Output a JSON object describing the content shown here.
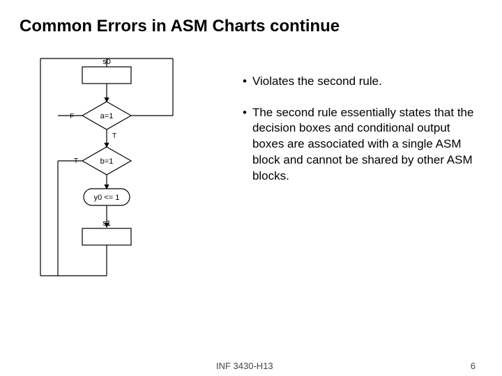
{
  "title": "Common Errors in ASM Charts continue",
  "bullets": [
    "Violates the second rule.",
    "The second rule essentially states that the decision boxes and conditional output boxes are associated with a single ASM block and cannot be shared by other ASM blocks."
  ],
  "diagram": {
    "state0": "s0",
    "state1": "s1",
    "cond1": "a=1",
    "cond2": "b=1",
    "action": "y0 <= 1",
    "true": "T",
    "false": "F"
  },
  "footer": {
    "course": "INF 3430-H13",
    "page": "6"
  }
}
